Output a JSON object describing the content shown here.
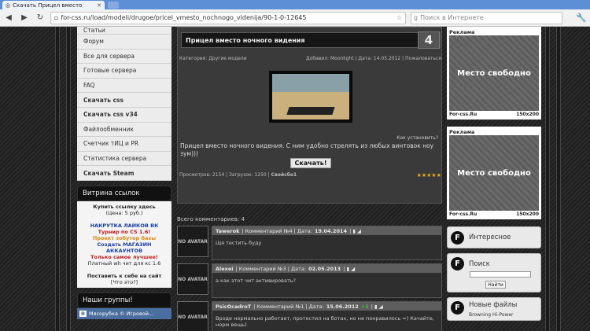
{
  "browser": {
    "tab_title": "Скачать Прицел вместо",
    "url": "for-css.ru/load/modeli/drugoe/pricel_vmesto_nochnogo_videnija/90-1-0-12645",
    "search_placeholder": "Поиск в Интернете"
  },
  "sidebar": {
    "menu": [
      "Статьи",
      "Форум",
      "Все для сервера",
      "Готовые сервера",
      "FAQ",
      "Скачать css",
      "Скачать css v34",
      "Файлообменник",
      "Счетчик тИЦ и PR",
      "Статистика сервера",
      "Скачать Steam"
    ],
    "bold_items": [
      5,
      6,
      10
    ],
    "showcase_title": "Витрина ссылок",
    "showcase": {
      "line1": "Купить ссылку здесь",
      "line2": "(Цена: 5 руб.)",
      "ad1": "НАКРУТКА ЛАЙКОВ ВК",
      "ad2": "Турнир по CS 1.6!",
      "ad3": "Проект зобутор базы",
      "ad4": "Создать МАГАЗИН",
      "ad5": "АККАУНТОВ",
      "ad6": "Только самое лучшее!",
      "ad7": "Платный wh чит для кс 1.6",
      "place": "Поставить к себе на сайт",
      "what": "[Что это?]"
    },
    "groups_title": "Наши группы!",
    "vk": "Мясорубка © Игровой..."
  },
  "news": {
    "title": "Прицел вместо ночного видения",
    "comments_badge": "4",
    "category": "Категория: Другие модели",
    "added": "Добавил: Moonlight | Дата: 14.05.2012 | Пожаловаться",
    "how_install": "Как установить?",
    "description": "Прицел вместо ночного видения. С ним удобно стрелять из любых винтовок ноу зум)))",
    "download": "Скачать!",
    "stats": "Просмотров: 2154 | Загрузок: 1250 |",
    "rated": "Свойсбо1",
    "stars": "★★★★★"
  },
  "comments": {
    "total": "Всего комментариев: 4",
    "avatar_text": "NO AVATAR",
    "items": [
      {
        "author": "Tawerok",
        "info": "| Комментарий №4 | Дата:",
        "date": "19.04.2014",
        "plus": "",
        "text": "Щя тестить буду"
      },
      {
        "author": "Alexei",
        "info": "| Комментарий №3 | Дата:",
        "date": "02.05.2013",
        "plus": "",
        "text": "а как этот чит активировать?"
      },
      {
        "author": "PsicOcadroT",
        "info": "| Комментарий №1 | Дата:",
        "date": "15.06.2012",
        "plus": "+1",
        "text": "Вроде нормально работает, протестил на ботах, но не понравилось =) Качайте, норм вещь)"
      }
    ]
  },
  "right": {
    "ad_label": "Реклама",
    "ad_text": "Место свободно",
    "ad_site": "For-css.Ru",
    "ad_size": "150х200",
    "interesting": "Интересное",
    "search_title": "Поиск",
    "search_btn": "Найти",
    "new_files": "Новые файлы",
    "new_file_item": "Browning Hi-Power"
  }
}
